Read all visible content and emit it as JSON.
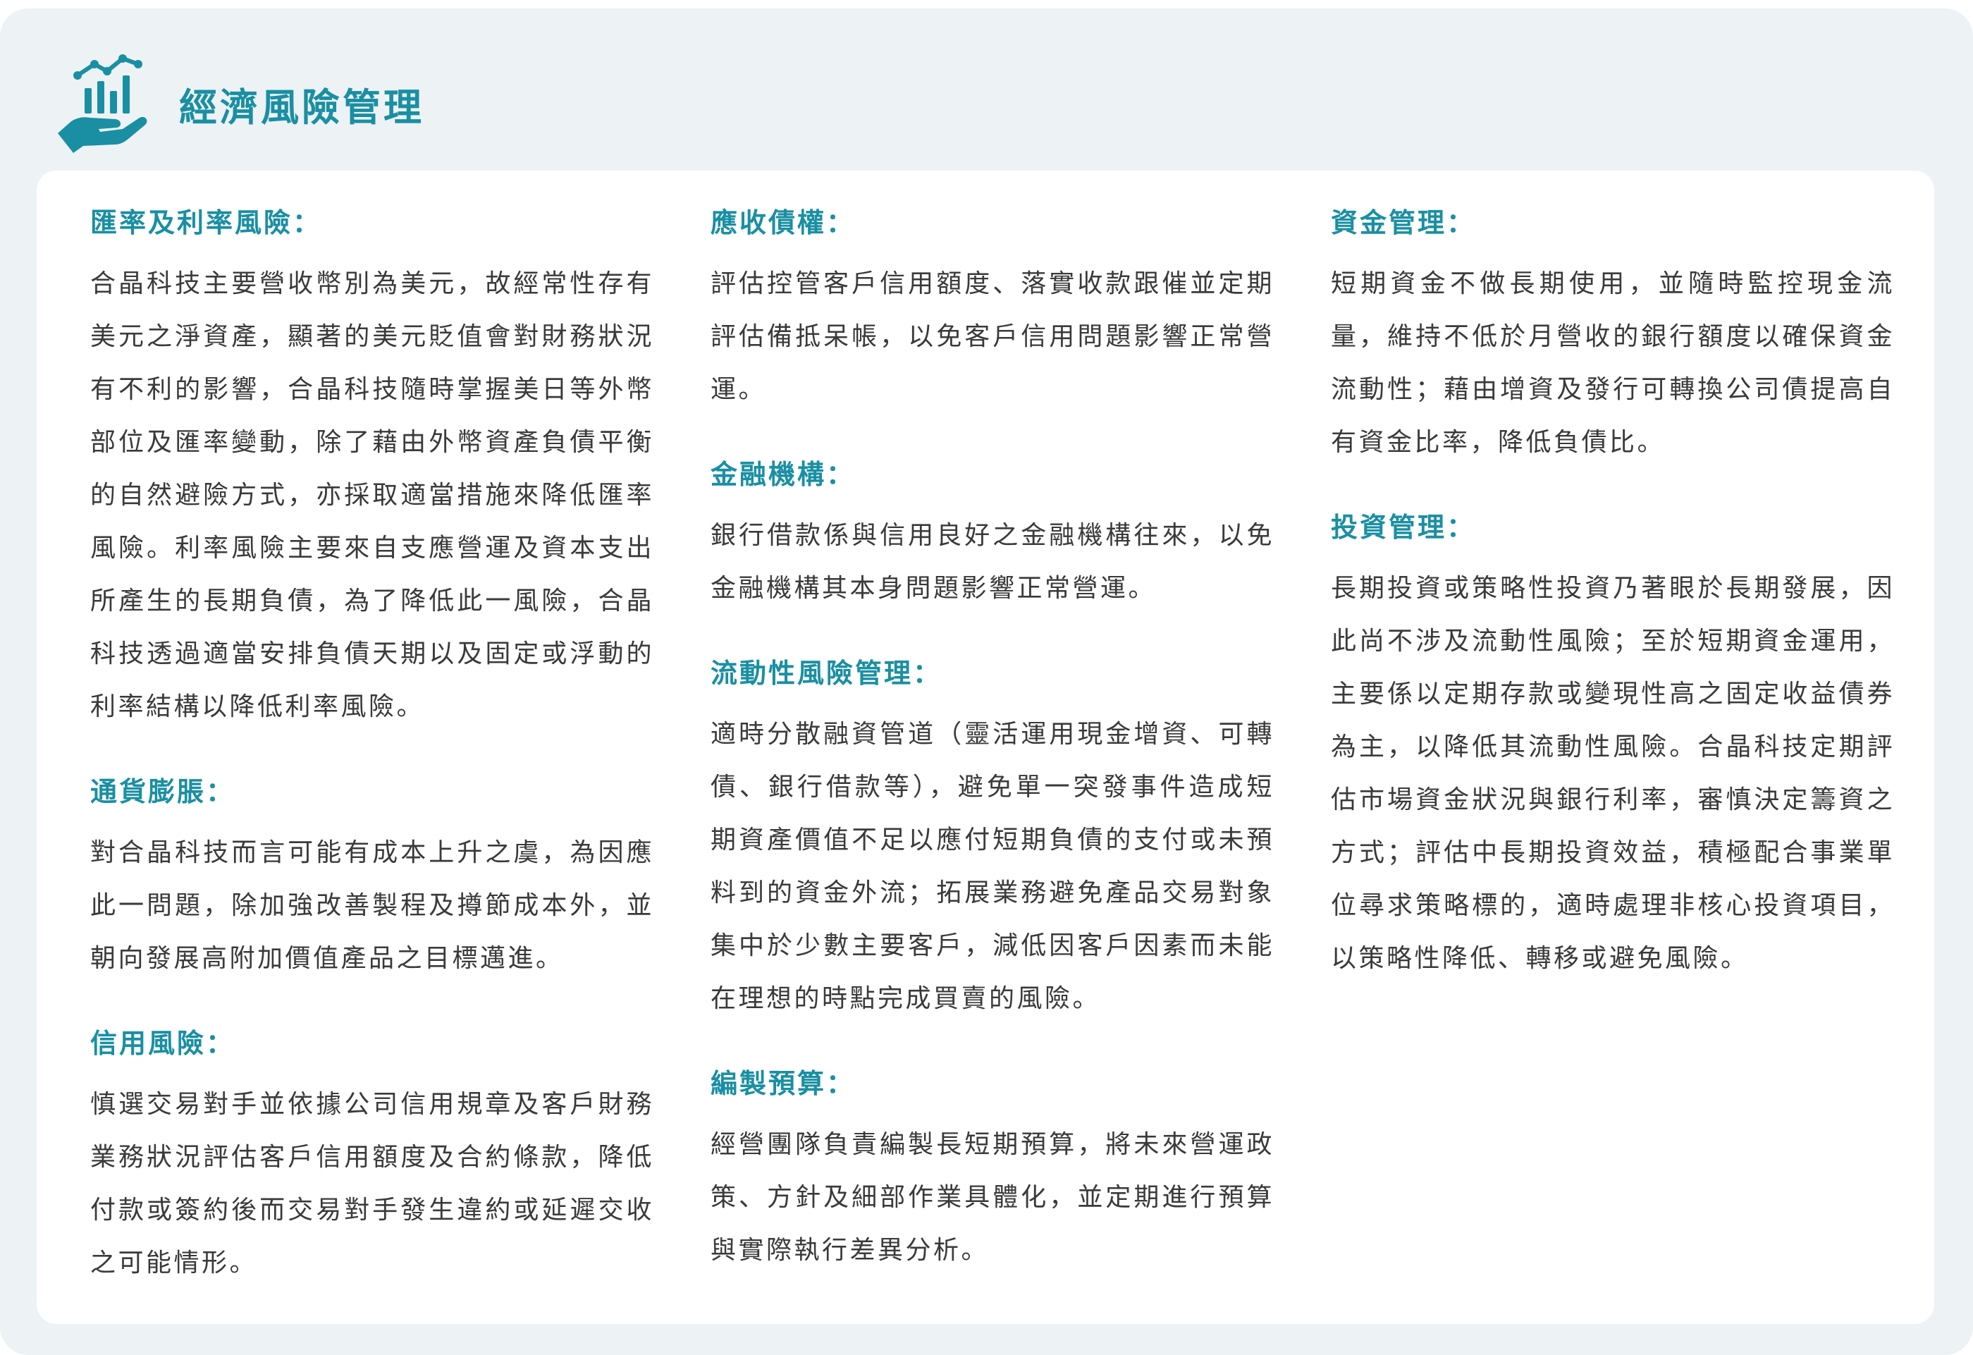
{
  "header": {
    "title": "經濟風險管理",
    "icon": "hand-chart-icon",
    "accent_color": "#1a8fa3"
  },
  "columns": [
    {
      "sections": [
        {
          "heading": "匯率及利率風險：",
          "body": "合晶科技主要營收幣別為美元，故經常性存有美元之淨資產，顯著的美元貶值會對財務狀況有不利的影響，合晶科技隨時掌握美日等外幣部位及匯率變動，除了藉由外幣資產負債平衡的自然避險方式，亦採取適當措施來降低匯率風險。利率風險主要來自支應營運及資本支出所產生的長期負債，為了降低此一風險，合晶科技透過適當安排負債天期以及固定或浮動的利率結構以降低利率風險。"
        },
        {
          "heading": "通貨膨脹：",
          "body": "對合晶科技而言可能有成本上升之虞，為因應此一問題，除加強改善製程及撙節成本外，並朝向發展高附加價值產品之目標邁進。"
        },
        {
          "heading": "信用風險：",
          "body": "慎選交易對手並依據公司信用規章及客戶財務業務狀況評估客戶信用額度及合約條款，降低付款或簽約後而交易對手發生違約或延遲交收之可能情形。"
        }
      ]
    },
    {
      "sections": [
        {
          "heading": "應收債權：",
          "body": "評估控管客戶信用額度、落實收款跟催並定期評估備抵呆帳，以免客戶信用問題影響正常營運。"
        },
        {
          "heading": "金融機構：",
          "body": "銀行借款係與信用良好之金融機構往來，以免金融機構其本身問題影響正常營運。"
        },
        {
          "heading": "流動性風險管理：",
          "body": "適時分散融資管道（靈活運用現金增資、可轉債、銀行借款等），避免單一突發事件造成短期資產價值不足以應付短期負債的支付或未預料到的資金外流；拓展業務避免產品交易對象集中於少數主要客戶，減低因客戶因素而未能在理想的時點完成買賣的風險。"
        },
        {
          "heading": "編製預算：",
          "body": "經營團隊負責編製長短期預算，將未來營運政策、方針及細部作業具體化，並定期進行預算與實際執行差異分析。"
        }
      ]
    },
    {
      "sections": [
        {
          "heading": "資金管理：",
          "body": "短期資金不做長期使用，並隨時監控現金流量，維持不低於月營收的銀行額度以確保資金流動性；藉由增資及發行可轉換公司債提高自有資金比率，降低負債比。"
        },
        {
          "heading": "投資管理：",
          "body": "長期投資或策略性投資乃著眼於長期發展，因此尚不涉及流動性風險；至於短期資金運用，主要係以定期存款或變現性高之固定收益債券為主，以降低其流動性風險。合晶科技定期評估市場資金狀況與銀行利率，審慎決定籌資之方式；評估中長期投資效益，積極配合事業單位尋求策略標的，適時處理非核心投資項目，以策略性降低、轉移或避免風險。"
        }
      ]
    }
  ]
}
